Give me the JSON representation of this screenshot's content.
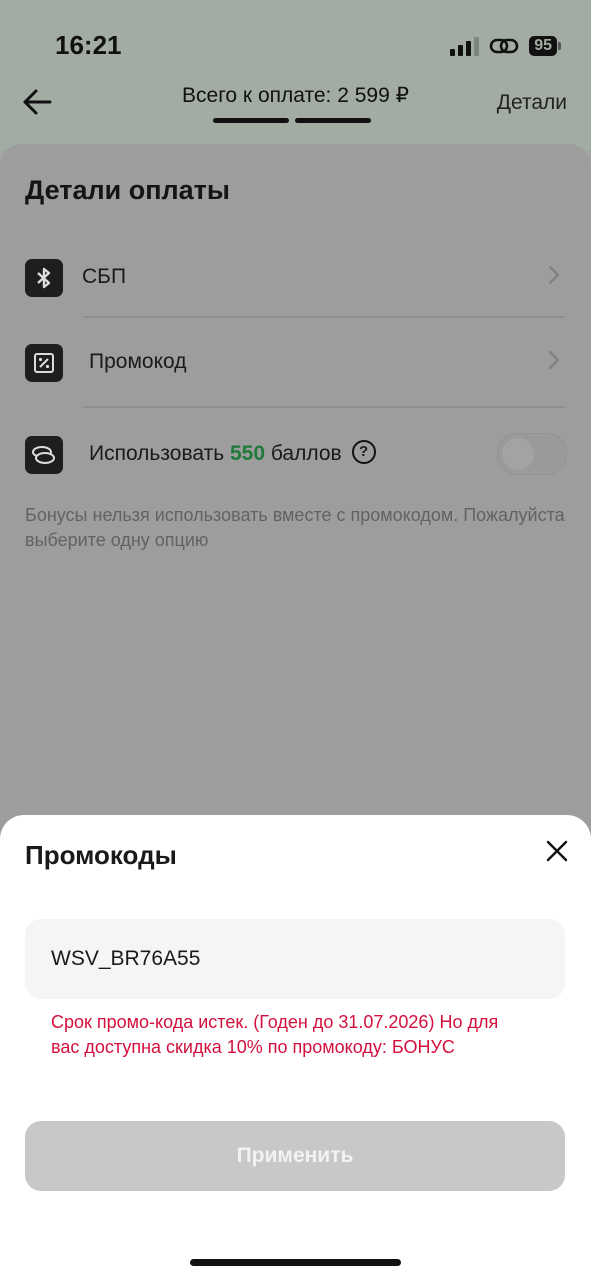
{
  "status_bar": {
    "time": "16:21",
    "battery": "95"
  },
  "header": {
    "title": "Всего к оплате: 2 599 ₽",
    "details_link": "Детали"
  },
  "payment_details": {
    "title": "Детали оплаты",
    "sbp_label": "СБП",
    "promo_label": "Промокод",
    "points_prefix": "Использовать",
    "points_value": "550",
    "points_suffix": "баллов",
    "points_toggle_on": false,
    "bonus_note": "Бонусы нельзя использовать вместе с промокодом. Пожалуйста выберите одну опцию"
  },
  "promo_sheet": {
    "title": "Промокоды",
    "input_value": "WSV_BR76A55",
    "error": "Срок промо-кода истек. (Годен до 31.07.2026) Но для вас доступна скидка 10% по промокоду: БОНУС",
    "apply_label": "Применить"
  },
  "colors": {
    "accent_green": "#1f7a3b",
    "error_red": "#d4103d",
    "disabled_button": "#c8c8c8"
  }
}
